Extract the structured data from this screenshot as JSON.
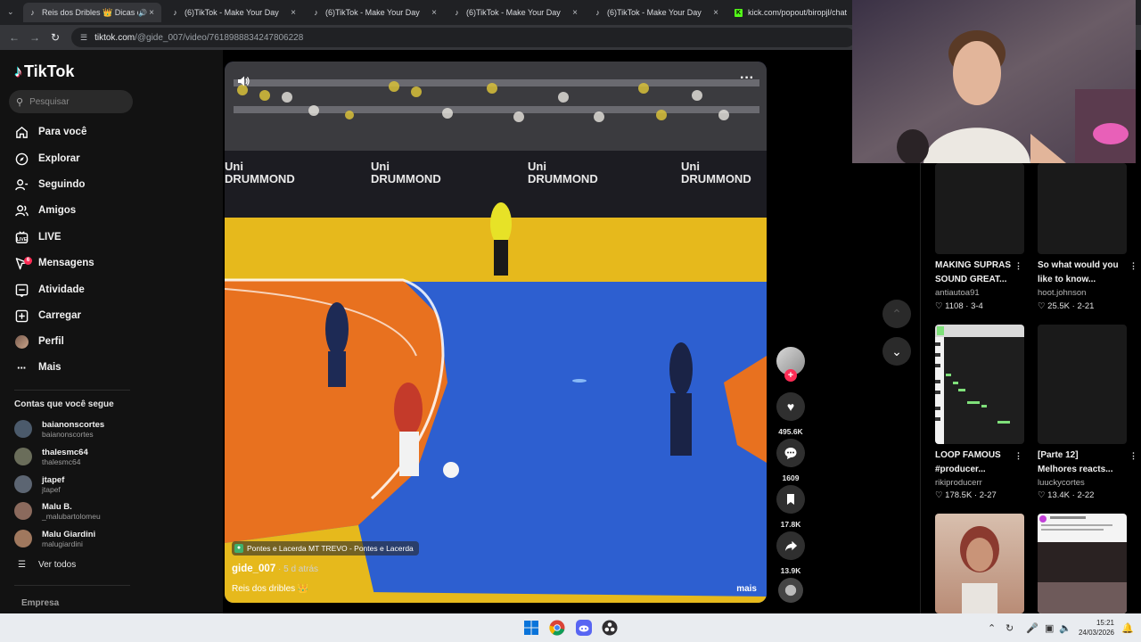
{
  "browser": {
    "tabs": [
      {
        "title": "Reis dos Dribles 👑 Dicas d",
        "active": true
      },
      {
        "title": "(6)TikTok - Make Your Day"
      },
      {
        "title": "(6)TikTok - Make Your Day"
      },
      {
        "title": "(6)TikTok - Make Your Day"
      },
      {
        "title": "(6)TikTok - Make Your Day"
      },
      {
        "title": "kick.com/popout/biropjl/chat"
      }
    ],
    "url_host": "tiktok.com",
    "url_path": "/@gide_007/video/7618988834247806228"
  },
  "sidebar": {
    "logo": "TikTok",
    "search_placeholder": "Pesquisar",
    "nav": [
      {
        "label": "Para você",
        "icon": "home-icon"
      },
      {
        "label": "Explorar",
        "icon": "compass-icon"
      },
      {
        "label": "Seguindo",
        "icon": "following-icon"
      },
      {
        "label": "Amigos",
        "icon": "friends-icon"
      },
      {
        "label": "LIVE",
        "icon": "live-icon"
      },
      {
        "label": "Mensagens",
        "icon": "messages-icon",
        "badge": "6"
      },
      {
        "label": "Atividade",
        "icon": "activity-icon"
      },
      {
        "label": "Carregar",
        "icon": "upload-icon"
      },
      {
        "label": "Perfil",
        "icon": "profile-avatar"
      },
      {
        "label": "Mais",
        "icon": "more-icon"
      }
    ],
    "following_title": "Contas que você segue",
    "accounts": [
      {
        "name": "baianonscortes",
        "user": "baianonscortes",
        "color": "#4b5a6b"
      },
      {
        "name": "thalesmc64",
        "user": "thalesmc64",
        "color": "#6a6d5a"
      },
      {
        "name": "jtapef",
        "user": "jtapef",
        "color": "#5c6572"
      },
      {
        "name": "Malu B.",
        "user": "_malubartolomeu",
        "color": "#8b6a5d"
      },
      {
        "name": "Malu Giardini",
        "user": "malugiardini",
        "color": "#a0785e"
      }
    ],
    "see_all": "Ver todos",
    "company": "Empresa"
  },
  "video": {
    "location": "Pontes e Lacerda MT TREVO - Pontes e Lacerda",
    "author": "gide_007",
    "time": " · 5 d atrás",
    "caption": "Reis dos dribles 👑",
    "more": "mais",
    "banner": "Uni DRUMMOND"
  },
  "actions": {
    "likes": "495.6K",
    "comments": "1609",
    "saves": "17.8K",
    "shares": "13.9K"
  },
  "right": {
    "cards": [
      {
        "title1": "MAKING SUPRAS",
        "title2": "SOUND GREAT...",
        "user": "antiautoa91",
        "likes": "1108",
        "date": "3-4"
      },
      {
        "title1": "So what would you",
        "title2": "like to know...",
        "user": "hoot.johnson",
        "likes": "25.5K",
        "date": "2-21"
      },
      {
        "title1": "LOOP FAMOUS",
        "title2": "#producer...",
        "user": "rikiproducerr",
        "likes": "178.5K",
        "date": "2-27"
      },
      {
        "title1": "[Parte 12]",
        "title2": "Melhores reacts...",
        "user": "luuckycortes",
        "likes": "13.4K",
        "date": "2-22"
      }
    ]
  },
  "taskbar": {
    "time": "15:21",
    "date": "24/03/2026"
  }
}
